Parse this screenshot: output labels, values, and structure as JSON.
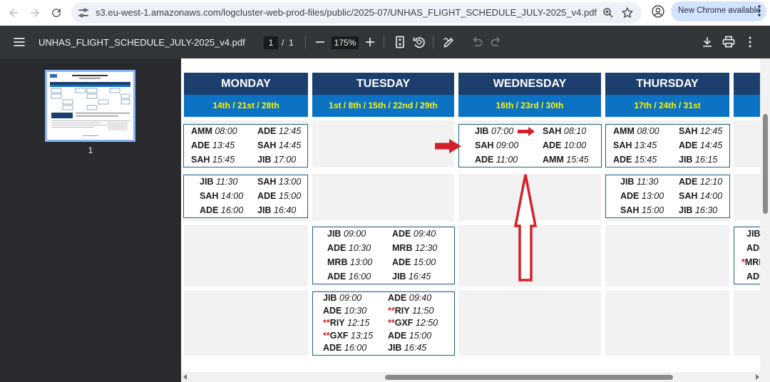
{
  "browser": {
    "url": "s3.eu-west-1.amazonaws.com/logcluster-web-prod-files/public/2025-07/UNHAS_FLIGHT_SCHEDULE_JULY-2025_v4.pdf",
    "update_label": "New Chrome available"
  },
  "pdf_toolbar": {
    "title": "UNHAS_FLIGHT_SCHEDULE_JULY-2025_v4.pdf",
    "current_page": "1",
    "page_separator": "/",
    "total_pages": "1",
    "zoom": "175%"
  },
  "sidebar": {
    "thumbnail_label": "1"
  },
  "icons": {
    "back": "arrow-left-icon",
    "forward": "arrow-right-icon",
    "reload": "reload-icon",
    "site_info": "tune-icon",
    "zoom": "zoom-icon",
    "bookmark": "star-icon",
    "profile": "account-icon",
    "menu": "hamburger-icon",
    "fit_page": "fit-page-icon",
    "rotate": "rotate-icon",
    "annotate": "pen-icon",
    "undo": "undo-icon",
    "redo": "redo-icon",
    "download": "download-icon",
    "print": "print-icon",
    "more": "kebab-icon"
  },
  "colors": {
    "day_header": "#1d3f6e",
    "date_header": "#0b72c4",
    "date_text": "#fff200",
    "box_border": "#1d5f8a",
    "arrow_red": "#d3202a"
  },
  "schedule": {
    "columns": [
      {
        "day": "MONDAY",
        "dates": "14th / 21st / 28th"
      },
      {
        "day": "TUESDAY",
        "dates": "1st / 8th / 15th / 22nd / 29th"
      },
      {
        "day": "WEDNESDAY",
        "dates": "16th / 23rd / 30th"
      },
      {
        "day": "THURSDAY",
        "dates": "17th / 24th / 31st"
      }
    ],
    "mon_r1": [
      [
        "AMM",
        "08:00",
        "ADE",
        "12:45"
      ],
      [
        "ADE",
        "13:45",
        "SAH",
        "14:45"
      ],
      [
        "SAH",
        "15:45",
        "JIB",
        "17:00"
      ]
    ],
    "mon_r2": [
      [
        "JIB",
        "11:30",
        "SAH",
        "13:00"
      ],
      [
        "SAH",
        "14:00",
        "ADE",
        "15:00"
      ],
      [
        "ADE",
        "16:00",
        "JIB",
        "16:40"
      ]
    ],
    "wed_r1": [
      [
        "JIB",
        "07:00",
        "SAH",
        "08:10"
      ],
      [
        "SAH",
        "09:00",
        "ADE",
        "10:00"
      ],
      [
        "ADE",
        "11:00",
        "AMM",
        "15:45"
      ]
    ],
    "thu_r1": [
      [
        "AMM",
        "08:00",
        "SAH",
        "12:45"
      ],
      [
        "SAH",
        "13:45",
        "ADE",
        "14:45"
      ],
      [
        "ADE",
        "15:45",
        "JIB",
        "16:15"
      ]
    ],
    "thu_r2": [
      [
        "JIB",
        "11:30",
        "ADE",
        "12:10"
      ],
      [
        "ADE",
        "13:00",
        "SAH",
        "14:00"
      ],
      [
        "SAH",
        "15:00",
        "JIB",
        "16:30"
      ]
    ],
    "tue_r3": [
      [
        "JIB",
        "09:00",
        "ADE",
        "09:40"
      ],
      [
        "ADE",
        "10:30",
        "MRB",
        "12:30"
      ],
      [
        "MRB",
        "13:00",
        "ADE",
        "15:00"
      ],
      [
        "ADE",
        "16:00",
        "JIB",
        "16:45"
      ]
    ],
    "tue_r4": [
      [
        "",
        "JIB",
        "09:00",
        "",
        "ADE",
        "09:40"
      ],
      [
        "",
        "ADE",
        "10:30",
        "**",
        "RIY",
        "11:50"
      ],
      [
        "**",
        "RIY",
        "12:15",
        "**",
        "GXF",
        "12:50"
      ],
      [
        "**",
        "GXF",
        "13:15",
        "",
        "ADE",
        "15:00"
      ],
      [
        "",
        "ADE",
        "16:00",
        "",
        "JIB",
        "16:45"
      ]
    ],
    "partial_col": [
      "JIB",
      "ADE",
      "*",
      "MRB",
      "ADE"
    ]
  }
}
